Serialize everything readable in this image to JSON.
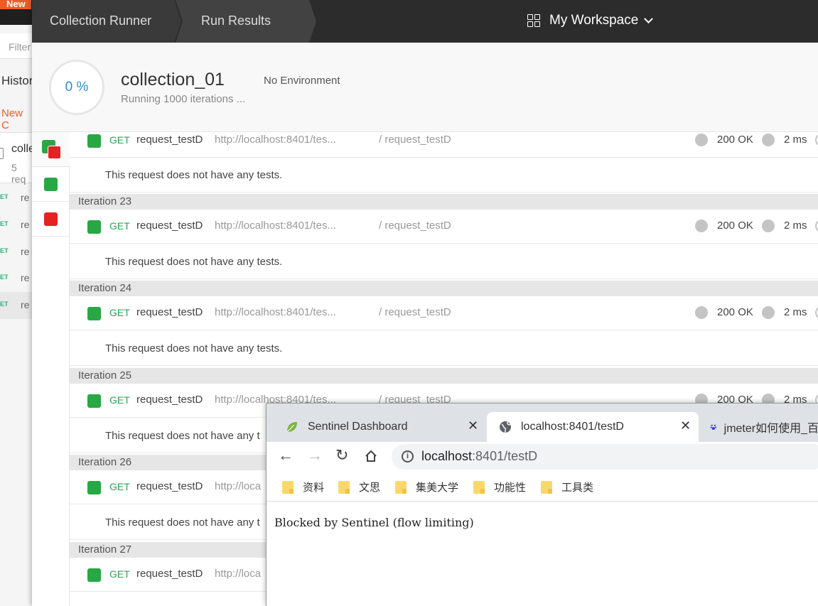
{
  "bg_app": {
    "new_button": "New",
    "filter_placeholder": "Filter",
    "history_tab": "Histor",
    "new_collection": "New C",
    "collection_name": "colle",
    "collection_sub": "5 req",
    "requests": [
      {
        "method": "ET",
        "name": "re"
      },
      {
        "method": "ET",
        "name": "re"
      },
      {
        "method": "ET",
        "name": "re"
      },
      {
        "method": "ET",
        "name": "re"
      },
      {
        "method": "ET",
        "name": "re"
      }
    ]
  },
  "runner": {
    "breadcrumb": [
      "Collection Runner",
      "Run Results"
    ],
    "workspace": "My Workspace",
    "progress": "0 %",
    "collection": "collection_01",
    "environment": "No Environment",
    "status": "Running 1000 iterations ..."
  },
  "results": {
    "iterations": [
      "Iteration 23",
      "Iteration 24",
      "Iteration 25",
      "Iteration 26",
      "Iteration 27"
    ],
    "request": {
      "method": "GET",
      "name": "request_testD",
      "url": "http://localhost:8401/tes...",
      "url_short": "http://loca",
      "path": "/ request_testD",
      "status": "200 OK",
      "time": "2 ms"
    },
    "no_tests": "This request does not have any tests.",
    "no_tests_short": "This request does not have any t"
  },
  "browser": {
    "tabs": [
      {
        "title": "Sentinel Dashboard",
        "icon": "leaf-icon"
      },
      {
        "title": "localhost:8401/testD",
        "icon": "globe-icon"
      },
      {
        "title": "jmeter如何使用_百",
        "icon": "paw-icon"
      }
    ],
    "url_host": "localhost",
    "url_rest": ":8401/testD",
    "bookmarks": [
      "资料",
      "文思",
      "集美大学",
      "功能性",
      "工具类"
    ],
    "page_text": "Blocked by Sentinel (flow limiting)"
  },
  "colors": {
    "pass": "#28a745",
    "fail": "#e52121",
    "accent": "#ef5b25",
    "progress": "#2e8bd8"
  }
}
